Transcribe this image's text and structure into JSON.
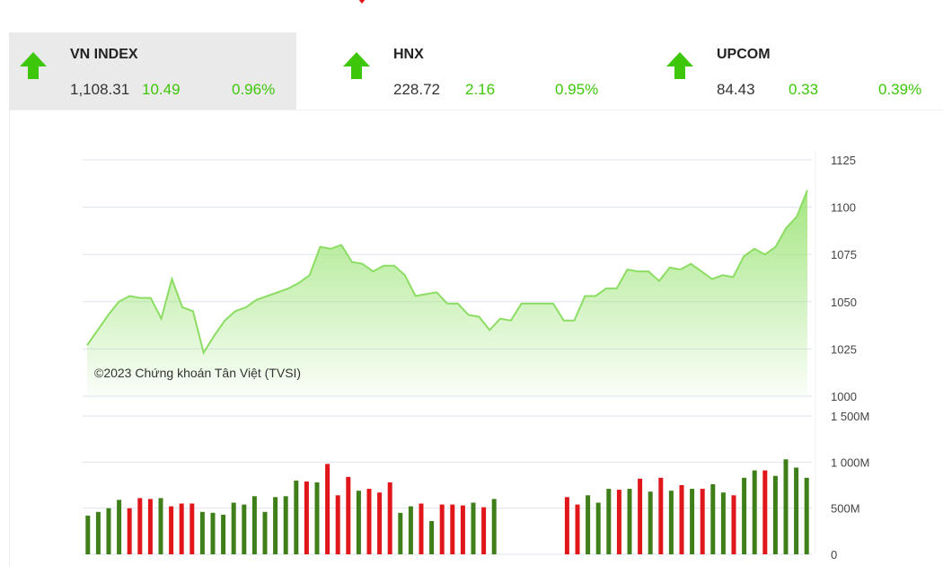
{
  "indices": [
    {
      "name": "VN INDEX",
      "value": "1,108.31",
      "change": "10.49",
      "percent": "0.96%",
      "direction": "up",
      "active": true
    },
    {
      "name": "HNX",
      "value": "228.72",
      "change": "2.16",
      "percent": "0.95%",
      "direction": "up",
      "active": false
    },
    {
      "name": "UPCOM",
      "value": "84.43",
      "change": "0.33",
      "percent": "0.39%",
      "direction": "up",
      "active": false
    }
  ],
  "colors": {
    "up": "#3ec70a",
    "down": "#e0161b",
    "vol_up": "#3f7f1a",
    "area_top": "#9fe57a",
    "area_line": "#8bdd63"
  },
  "chart_data": [
    {
      "type": "area",
      "series": [
        {
          "values": [
            1027,
            1035,
            1043,
            1050,
            1053,
            1052,
            1052,
            1041,
            1062,
            1047,
            1045,
            1023,
            1032,
            1040,
            1045,
            1047,
            1051,
            1053,
            1055,
            1057,
            1060,
            1064,
            1079,
            1078,
            1080,
            1071,
            1070,
            1066,
            1069,
            1069,
            1064,
            1053,
            1054,
            1055,
            1049,
            1049,
            1043,
            1042,
            1035,
            1041,
            1040,
            1049,
            1049,
            1049,
            1049,
            1040,
            1040,
            1053,
            1053,
            1057,
            1057,
            1067,
            1066,
            1066,
            1061,
            1068,
            1067,
            1070,
            1066,
            1062,
            1064,
            1063,
            1074,
            1078,
            1075,
            1079,
            1089,
            1095,
            1109
          ]
        }
      ],
      "ylim": [
        1000,
        1125
      ],
      "yticks": [
        "1125",
        "1100",
        "1075",
        "1050",
        "1025",
        "1000"
      ],
      "annotation": "©2023 Chứng khoán Tân Việt (TVSI)",
      "grid": true
    },
    {
      "type": "bar",
      "series": [
        {
          "values": [
            420,
            460,
            500,
            590,
            500,
            610,
            600,
            610,
            520,
            550,
            550,
            460,
            450,
            430,
            560,
            540,
            630,
            460,
            620,
            630,
            800,
            790,
            780,
            980,
            640,
            840,
            690,
            710,
            670,
            780,
            450,
            520,
            550,
            360,
            540,
            540,
            530,
            560,
            510,
            600,
            null,
            null,
            null,
            null,
            null,
            null,
            620,
            540,
            640,
            560,
            710,
            700,
            710,
            820,
            680,
            830,
            690,
            750,
            710,
            710,
            760,
            670,
            640,
            830,
            910,
            910,
            850,
            1030,
            940,
            830
          ],
          "directions": [
            "g",
            "g",
            "g",
            "g",
            "r",
            "r",
            "r",
            "g",
            "r",
            "r",
            "r",
            "g",
            "g",
            "g",
            "g",
            "g",
            "g",
            "g",
            "g",
            "g",
            "g",
            "r",
            "g",
            "r",
            "r",
            "r",
            "g",
            "r",
            "r",
            "r",
            "g",
            "g",
            "r",
            "g",
            "r",
            "r",
            "r",
            "g",
            "r",
            "g",
            null,
            null,
            null,
            null,
            null,
            null,
            "r",
            "r",
            "g",
            "g",
            "g",
            "r",
            "g",
            "r",
            "g",
            "r",
            "g",
            "r",
            "g",
            "r",
            "g",
            "g",
            "r",
            "g",
            "g",
            "r",
            "g",
            "g",
            "g",
            "g"
          ]
        }
      ],
      "ylim": [
        0,
        1500
      ],
      "yticks": [
        "1 500M",
        "1 000M",
        "500M",
        "0"
      ],
      "grid": true
    }
  ]
}
